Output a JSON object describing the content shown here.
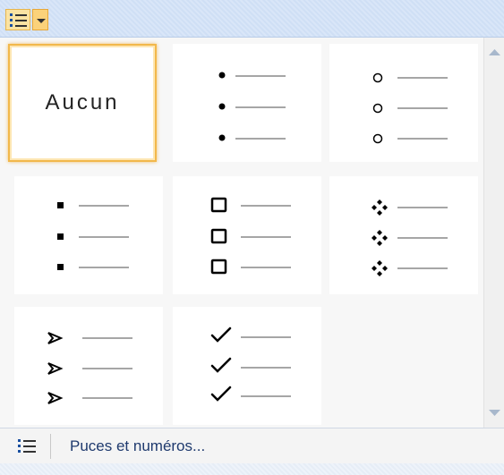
{
  "toolbar": {
    "list_icon": "bullet-list-icon",
    "dropdown_icon": "dropdown-arrow-icon"
  },
  "gallery": {
    "items": [
      {
        "type": "none",
        "label": "Aucun",
        "selected": true
      },
      {
        "type": "bullet",
        "symbol": "filled-dot-bullet"
      },
      {
        "type": "bullet",
        "symbol": "hollow-circle-bullet"
      },
      {
        "type": "bullet",
        "symbol": "filled-square-bullet"
      },
      {
        "type": "bullet",
        "symbol": "hollow-square-bullet"
      },
      {
        "type": "bullet",
        "symbol": "four-diamond-bullet"
      },
      {
        "type": "bullet",
        "symbol": "arrowhead-bullet"
      },
      {
        "type": "bullet",
        "symbol": "checkmark-bullet"
      }
    ]
  },
  "scrollbar": {
    "up_icon": "scroll-up-arrow-icon",
    "down_icon": "scroll-down-arrow-icon"
  },
  "footer": {
    "icon": "bullet-list-icon",
    "label": "Puces et numéros..."
  }
}
